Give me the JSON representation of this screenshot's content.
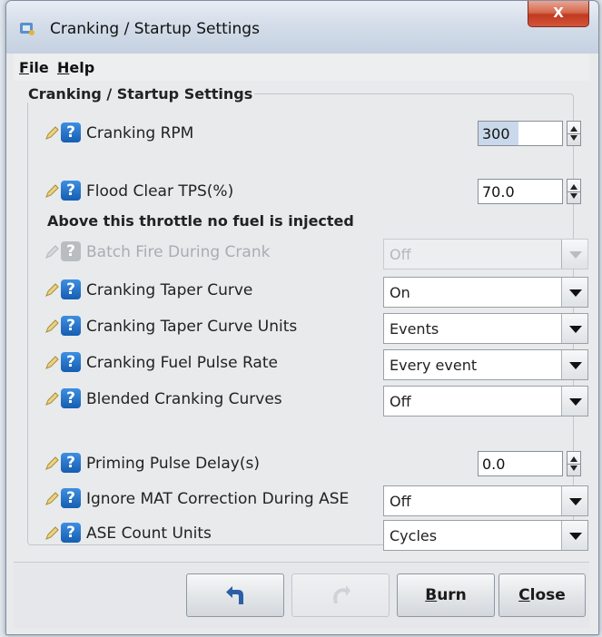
{
  "window": {
    "title": "Cranking / Startup Settings",
    "close_glyph": "X"
  },
  "menu": [
    {
      "first": "F",
      "rest": "ile"
    },
    {
      "first": "H",
      "rest": "elp"
    }
  ],
  "group_title": "Cranking / Startup Settings",
  "help_glyph": "?",
  "fields": {
    "cranking_rpm": {
      "label": "Cranking RPM",
      "value": "300"
    },
    "flood_clear": {
      "label": "Flood Clear TPS(%)",
      "value": "70.0"
    },
    "note": "Above this throttle no fuel is injected",
    "batch_fire": {
      "label": "Batch Fire During Crank",
      "value": "Off"
    },
    "taper_curve": {
      "label": "Cranking Taper Curve",
      "value": "On"
    },
    "taper_units": {
      "label": "Cranking Taper Curve Units",
      "value": "Events"
    },
    "pulse_rate": {
      "label": "Cranking Fuel Pulse Rate",
      "value": "Every event"
    },
    "blended": {
      "label": "Blended Cranking Curves",
      "value": "Off"
    },
    "priming_delay": {
      "label": "Priming Pulse Delay(s)",
      "value": "0.0"
    },
    "ignore_mat": {
      "label": "Ignore MAT Correction During ASE",
      "value": "Off"
    },
    "ase_units": {
      "label": "ASE Count Units",
      "value": "Cycles"
    }
  },
  "footer": {
    "burn": {
      "first": "B",
      "rest": "urn"
    },
    "close": {
      "first": "C",
      "rest": "lose"
    }
  },
  "colors": {
    "help_icon": "#1f6fc8",
    "close_button": "#c8452c"
  }
}
